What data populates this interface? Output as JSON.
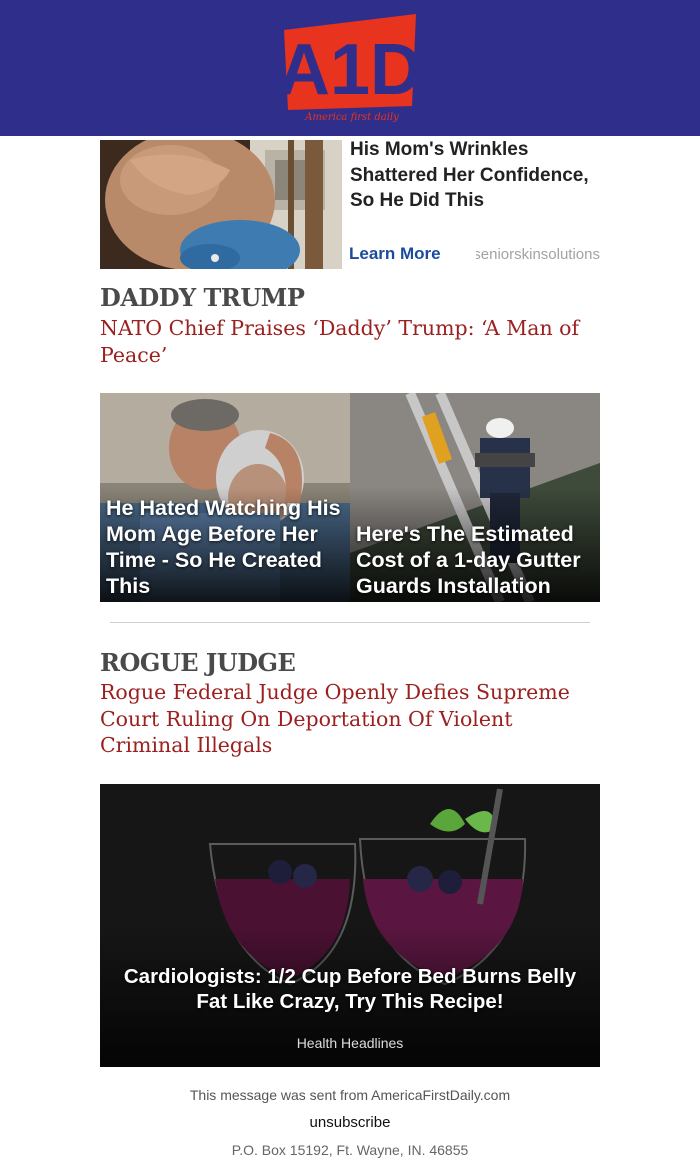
{
  "header": {
    "logo_text": "A1D",
    "logo_tagline": "America first daily",
    "background_color": "#2f2e8b",
    "logo_color": "#e8331e"
  },
  "ad_top": {
    "title": "His Mom's Wrinkles Shattered Her Confidence, So He Did This",
    "cta": "Learn More",
    "source": "seniorskinsolutions"
  },
  "article_1": {
    "section": "DADDY TRUMP",
    "headline": "NATO Chief Praises ‘Daddy’ Trump: ‘A Man of Peace’"
  },
  "ad_grid": [
    {
      "title": "He Hated Watching His Mom Age Before Her Time - So He Created This"
    },
    {
      "title": "Here's The Estimated Cost of a 1-day Gutter Guards Installation"
    }
  ],
  "article_2": {
    "section": "ROGUE JUDGE",
    "headline": "Rogue Federal Judge Openly Defies Supreme Court Ruling On Deportation Of Violent Criminal Illegals"
  },
  "ad_big": {
    "title": "Cardiologists: 1/2 Cup Before Bed Burns Belly Fat Like Crazy, Try This Recipe!",
    "source": "Health Headlines"
  },
  "footer": {
    "sent_from": "This message was sent from AmericaFirstDaily.com",
    "unsubscribe": "unsubscribe",
    "address": "P.O. Box 15192, Ft. Wayne, IN. 46855"
  },
  "colors": {
    "headline_link": "#9b2020",
    "section_head": "#4a4a4a",
    "cta_link": "#1b4c9c"
  }
}
